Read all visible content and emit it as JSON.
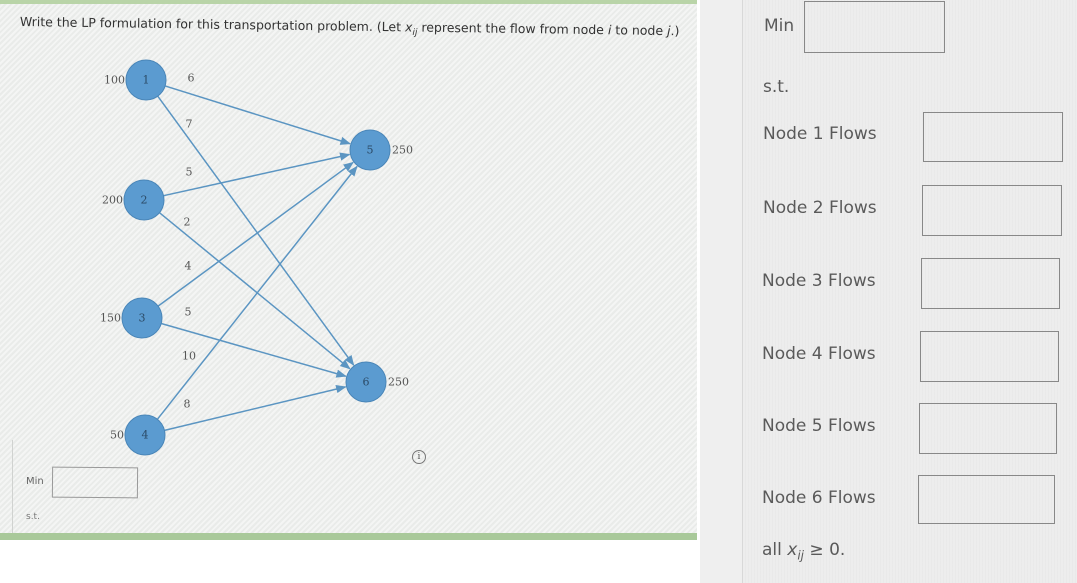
{
  "question": {
    "prefix": "Write the LP formulation for this transportation problem. (Let ",
    "var": "x",
    "subscript": "ij",
    "suffix_mid": " represent the flow from node ",
    "i": "i",
    "to": " to node ",
    "j": "j",
    "suffix_end": ".)"
  },
  "diagram": {
    "sources": [
      {
        "id": "1",
        "supply": "100"
      },
      {
        "id": "2",
        "supply": "200"
      },
      {
        "id": "3",
        "supply": "150"
      },
      {
        "id": "4",
        "supply": "50"
      }
    ],
    "destinations": [
      {
        "id": "5",
        "demand": "250"
      },
      {
        "id": "6",
        "demand": "250"
      }
    ],
    "edges": [
      {
        "from": "1",
        "to": "5",
        "cost": "6"
      },
      {
        "from": "1",
        "to": "6",
        "cost": "7"
      },
      {
        "from": "2",
        "to": "5",
        "cost": "5"
      },
      {
        "from": "2",
        "to": "6",
        "cost": "2"
      },
      {
        "from": "3",
        "to": "5",
        "cost": "4"
      },
      {
        "from": "3",
        "to": "6",
        "cost": "5"
      },
      {
        "from": "4",
        "to": "5",
        "cost": "10"
      },
      {
        "from": "4",
        "to": "6",
        "cost": "8"
      }
    ],
    "info_icon": "i"
  },
  "left_form": {
    "min_label": "Min",
    "min_value": "",
    "st_label": "s.t."
  },
  "right_form": {
    "min_label": "Min",
    "min_value": "",
    "st_label": "s.t.",
    "constraints": [
      {
        "label": "Node 1 Flows",
        "value": ""
      },
      {
        "label": "Node 2 Flows",
        "value": ""
      },
      {
        "label": "Node 3 Flows",
        "value": ""
      },
      {
        "label": "Node 4 Flows",
        "value": ""
      },
      {
        "label": "Node 5 Flows",
        "value": ""
      },
      {
        "label": "Node 6 Flows",
        "value": ""
      }
    ],
    "nonneg": {
      "prefix": "all ",
      "var": "x",
      "sub": "ij",
      "suffix": " ≥ 0."
    }
  }
}
